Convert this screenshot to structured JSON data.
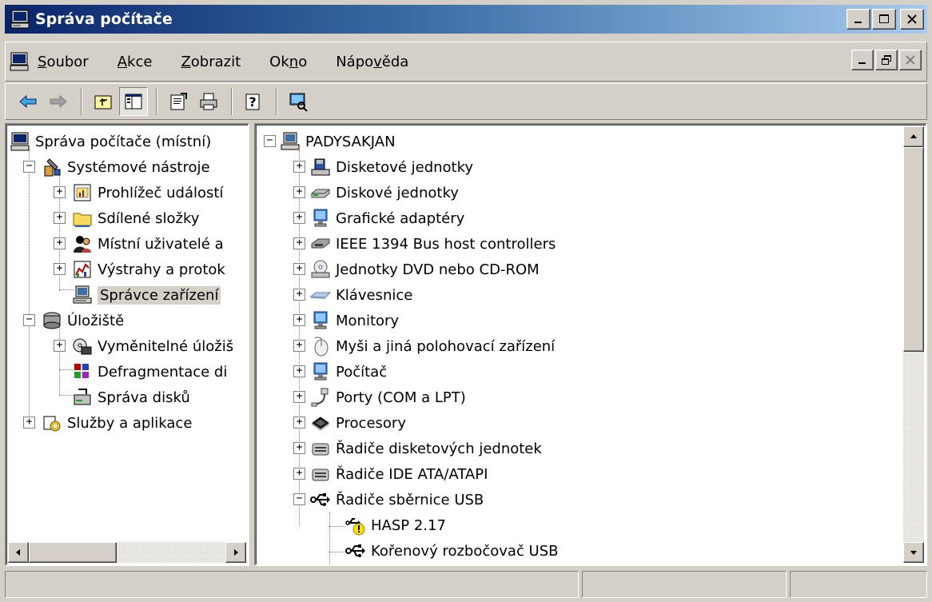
{
  "window": {
    "title": "Správa počítače"
  },
  "menu": {
    "items": [
      {
        "label": "Soubor",
        "u": "S",
        "rest": "oubor"
      },
      {
        "label": "Akce",
        "u": "A",
        "rest": "kce"
      },
      {
        "label": "Zobrazit",
        "u": "Z",
        "rest": "obrazit"
      },
      {
        "label": "Okno",
        "pre": "Ok",
        "u": "n",
        "rest": "o"
      },
      {
        "label": "Nápověda",
        "pre": "Nápo",
        "u": "v",
        "rest": "ěda"
      }
    ]
  },
  "left_tree": {
    "root": "Správa počítače (místní)",
    "system_tools": "Systémové nástroje",
    "event_viewer": "Prohlížeč událostí",
    "shared_folders": "Sdílené složky",
    "local_users": "Místní uživatelé a",
    "alerts": "Výstrahy a protok",
    "device_manager": "Správce zařízení",
    "storage": "Úložiště",
    "removable_storage": "Vyměnitelné úložiš",
    "defrag": "Defragmentace di",
    "disk_management": "Správa disků",
    "services": "Služby a aplikace"
  },
  "right_tree": {
    "root": "PADYSAKJAN",
    "floppy_drives": "Disketové jednotky",
    "disk_drives": "Diskové jednotky",
    "display_adapters": "Grafické adaptéry",
    "ieee1394": "IEEE 1394 Bus host controllers",
    "dvd_cdrom": "Jednotky DVD nebo CD-ROM",
    "keyboards": "Klávesnice",
    "monitors": "Monitory",
    "mice": "Myši a jiná polohovací zařízení",
    "computer": "Počítač",
    "ports": "Porty (COM a LPT)",
    "processors": "Procesory",
    "floppy_controllers": "Řadiče disketových jednotek",
    "ide_controllers": "Řadiče IDE ATA/ATAPI",
    "usb_controllers": "Řadiče sběrnice USB",
    "hasp": "HASP 2.17",
    "usb_root_hub": "Kořenový rozbočovač USB"
  },
  "colors": {
    "title_start": "#0a246a",
    "title_end": "#a6caf0",
    "face": "#d4d0c8"
  }
}
